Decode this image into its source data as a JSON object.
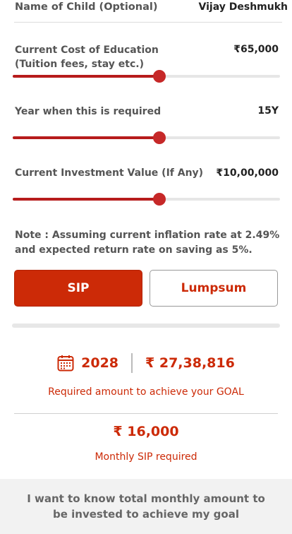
{
  "child": {
    "label": "Name of Child (Optional)",
    "value": "Vijay Deshmukh"
  },
  "fields": [
    {
      "label_line1": "Current Cost of Education",
      "label_line2": "(Tuition fees, stay etc.)",
      "value": "₹65,000",
      "fraction": 0.55
    },
    {
      "label_line1": "Year when this is required",
      "value": "15Y",
      "fraction": 0.55
    },
    {
      "label_line1": "Current Investment Value (If Any)",
      "value": "₹10,00,000",
      "fraction": 0.55
    }
  ],
  "note": "Note : Assuming current inflation rate at 2.49% and expected return rate on saving as 5%.",
  "buttons": {
    "sip": "SIP",
    "lumpsum": "Lumpsum"
  },
  "result": {
    "year": "2028",
    "amount": "₹ 27,38,816",
    "caption": "Required amount to achieve your GOAL",
    "monthly_sip": "₹ 16,000",
    "monthly_caption": "Monthly SIP required"
  },
  "cta": "I want to know total monthly amount to be invested to achieve my goal",
  "colors": {
    "accent": "#cc2a07",
    "slider": "#b71c1c"
  },
  "icons": {
    "calendar": "calendar-icon"
  }
}
